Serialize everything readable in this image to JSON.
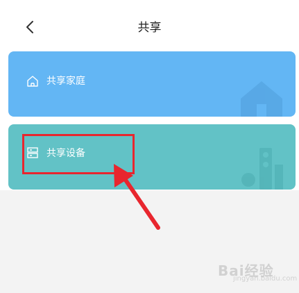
{
  "header": {
    "title": "共享",
    "back_icon": "chevron-left-icon"
  },
  "cards": {
    "share_home": {
      "label": "共享家庭",
      "icon": "home-icon",
      "color": "#63b6f4"
    },
    "share_device": {
      "label": "共享设备",
      "icon": "device-icon",
      "color": "#62c2c6"
    }
  },
  "annotation": {
    "highlight_color": "#e8262e"
  },
  "watermark": {
    "text": "Bai",
    "text2": "经验",
    "sub": "jingyan.baidu.com"
  }
}
